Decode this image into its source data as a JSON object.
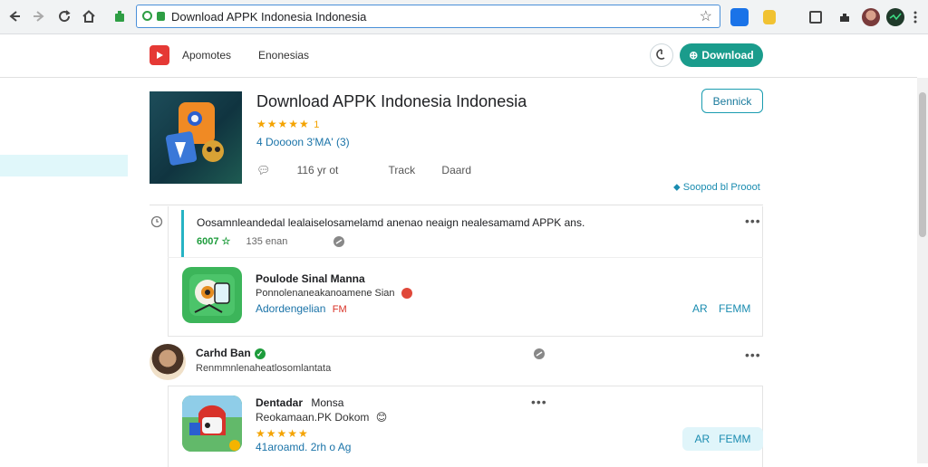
{
  "browser": {
    "address": "Download APPK Indonesia Indonesia",
    "icons": [
      "back-arrow-icon",
      "forward-arrow-icon",
      "reload-icon",
      "home-icon",
      "star-icon"
    ]
  },
  "header": {
    "nav_1": "Apomotes",
    "nav_2": "Enonesias",
    "download_label": "Download"
  },
  "app": {
    "title": "Download APPK Indonesia Indonesia",
    "stars": "★★★★★",
    "rating_suffix": "1",
    "meta": "4 Doooon 3'MA' (3)",
    "stat_1": "116 yr ot",
    "stat_2": "Track",
    "stat_3": "Daard",
    "bookmark_label": "Bennick",
    "report_label": "Soopod bl Prooot"
  },
  "post1": {
    "text": "Oosamnleandedal lealaiselosamelamd anenao neaign nealesamamd APPK ans.",
    "score": "6007 ☆",
    "sub": "135 enan",
    "inner": {
      "title": "Poulode Sinal Manna",
      "line": "Ponnolenaneakanoamene Sian",
      "link": "Adordengelian",
      "badge": "FM",
      "action_1": "AR",
      "action_2": "FEMM"
    }
  },
  "post2": {
    "author": "Carhd Ban",
    "subtitle": "Renmmnlenaheatlosomlantata",
    "inner": {
      "title_1": "Dentadar",
      "title_2": "Monsa",
      "line": "Reokamaan.PK Dokom",
      "stars": "★★★★★",
      "meta": "41aroamd. 2rh o Ag",
      "action_1": "AR",
      "action_2": "FEMM"
    }
  },
  "colors": {
    "accent_teal": "#1a9c8c",
    "brand_red": "#e53935",
    "link_blue": "#1a73a8",
    "star_gold": "#f4a300"
  }
}
